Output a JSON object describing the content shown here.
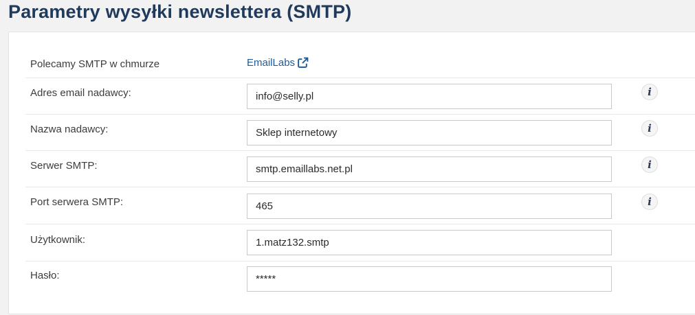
{
  "page": {
    "title": "Parametry wysyłki newslettera (SMTP)"
  },
  "recommend": {
    "label": "Polecamy SMTP w chmurze",
    "link_text": "EmailLabs",
    "link_icon": "external-link-icon"
  },
  "fields": [
    {
      "label": "Adres email nadawcy:",
      "value": "info@selly.pl",
      "info_icon": "info-icon"
    },
    {
      "label": "Nazwa nadawcy:",
      "value": "Sklep internetowy",
      "info_icon": "info-icon"
    },
    {
      "label": "Serwer SMTP:",
      "value": "smtp.emaillabs.net.pl",
      "info_icon": "info-icon"
    },
    {
      "label": "Port serwera SMTP:",
      "value": "465",
      "info_icon": "info-icon"
    },
    {
      "label": "Użytkownik:",
      "value": "1.matz132.smtp"
    },
    {
      "label": "Hasło:",
      "value": "*****"
    }
  ],
  "info_glyph": "i",
  "colors": {
    "title": "#1f3a5a",
    "link": "#1f5a96",
    "background": "#f2f2f2",
    "panel": "#ffffff"
  }
}
